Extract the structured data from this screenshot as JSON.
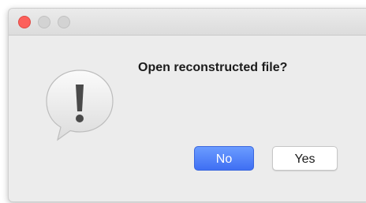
{
  "dialog": {
    "message": "Open reconstructed file?",
    "icon": "exclamation-alert-icon",
    "buttons": {
      "no_label": "No",
      "yes_label": "Yes"
    }
  },
  "colors": {
    "close": "#fc605b",
    "inactive_traffic": "#d3d3d3",
    "default_button": "#4a7cf6",
    "window_bg": "#ececec"
  }
}
